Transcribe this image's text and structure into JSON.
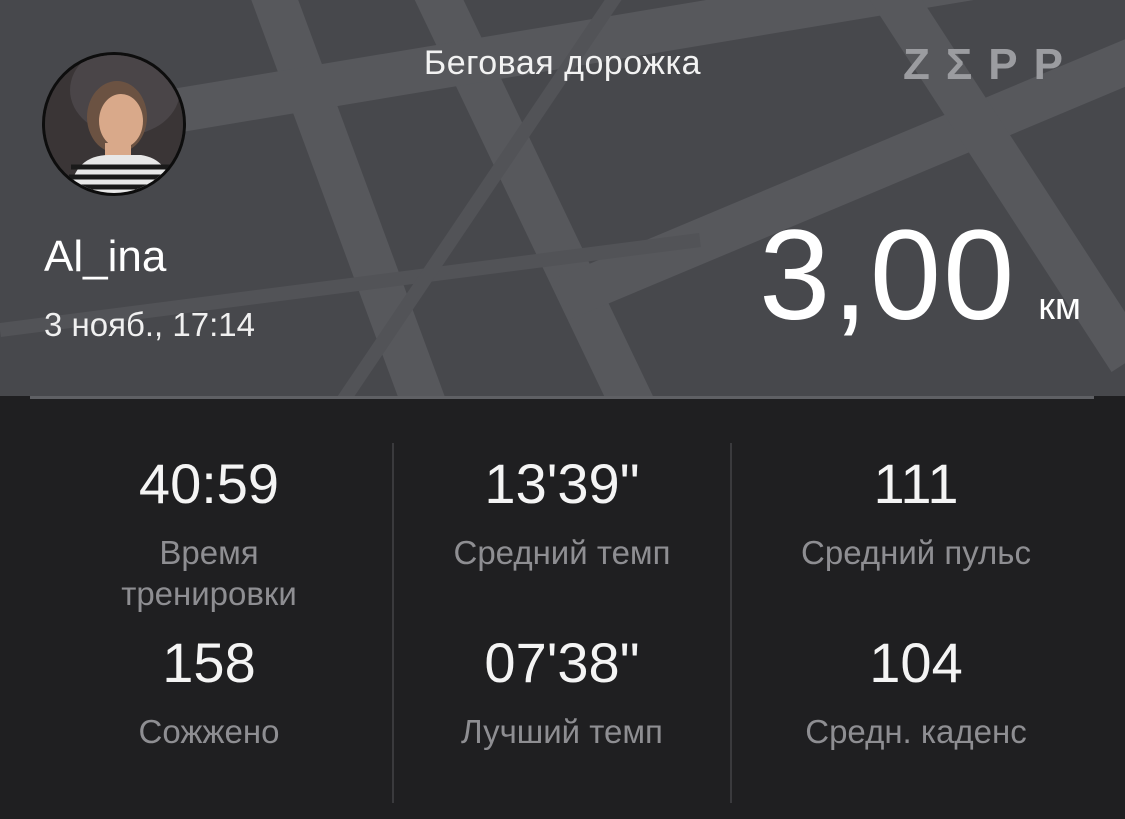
{
  "header": {
    "title": "Беговая дорожка",
    "brand": "ZΣPP",
    "user_name": "Al_ina",
    "date_time": "3 нояб., 17:14",
    "distance_value": "3,00",
    "distance_unit": "км"
  },
  "stats": [
    {
      "value": "40:59",
      "label": "Время тренировки"
    },
    {
      "value": "13'39\"",
      "label": "Средний темп"
    },
    {
      "value": "111",
      "label": "Средний пульс"
    },
    {
      "value": "158",
      "label": "Сожжено"
    },
    {
      "value": "07'38\"",
      "label": "Лучший темп"
    },
    {
      "value": "104",
      "label": "Средн. каденс"
    }
  ],
  "icons": {
    "avatar": "avatar-photo",
    "logo": "zepp-logo"
  },
  "colors": {
    "header_bg": "#47484c",
    "stats_bg": "#1f1f21",
    "value_text": "#f4f4f4",
    "label_text": "#8e8e92"
  }
}
